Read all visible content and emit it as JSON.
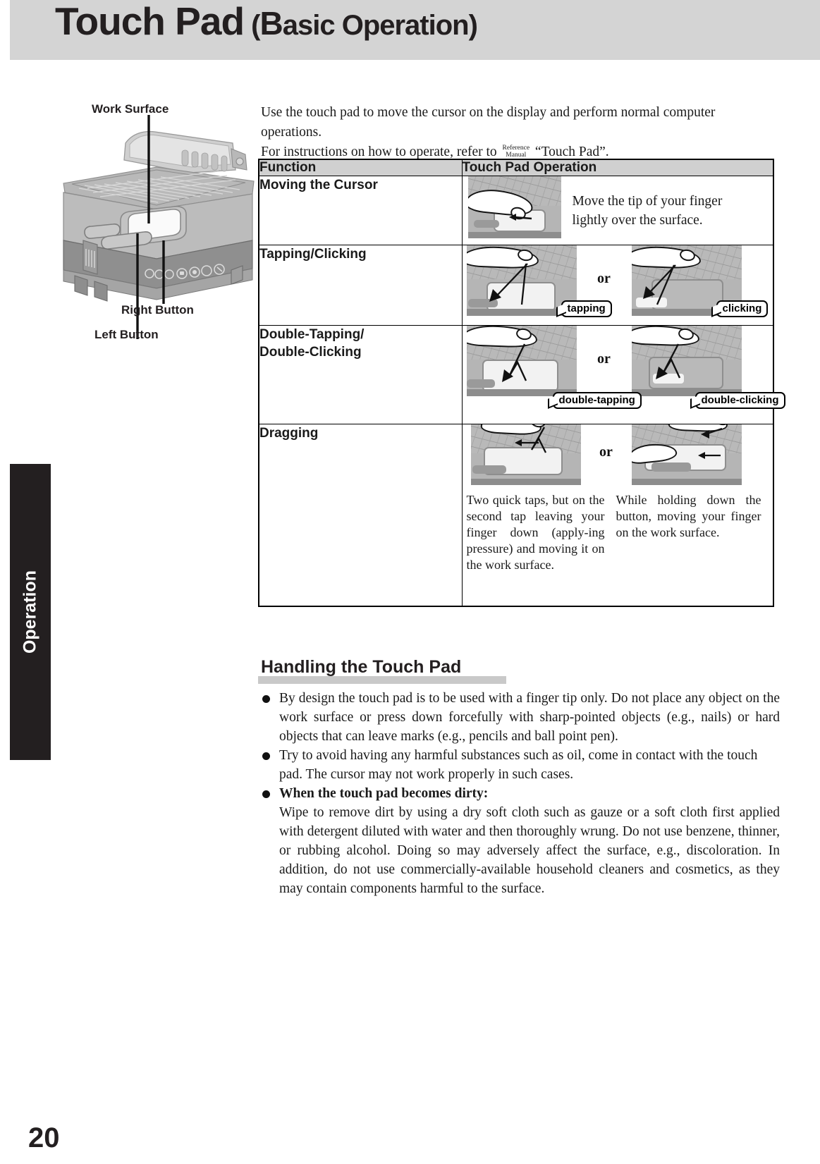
{
  "header": {
    "title_main": "Touch Pad",
    "title_paren_open": "(",
    "title_cap": "B",
    "title_rest": "asic Operation",
    "title_paren_close": ")"
  },
  "side_tab": {
    "label": "Operation"
  },
  "page": {
    "number": "20"
  },
  "illustration": {
    "labels": {
      "work_surface": "Work Surface",
      "right_button": "Right Button",
      "left_button": "Left Button"
    }
  },
  "intro": {
    "line1": "Use the touch pad to move the cursor on the display and perform normal computer operations.",
    "line2_a": "For instructions on how to operate, refer to",
    "ref_icon_line1": "Reference",
    "ref_icon_line2": "Manual",
    "line2_b": "“Touch Pad”."
  },
  "table": {
    "headers": {
      "function": "Function",
      "operation": "Touch Pad Operation"
    },
    "rows": [
      {
        "function": "Moving the Cursor",
        "description": "Move the tip of your finger lightly over the surface."
      },
      {
        "function": "Tapping/Clicking",
        "or": "or",
        "callout_left": "tapping",
        "callout_right": "clicking"
      },
      {
        "function_line1": "Double-Tapping/",
        "function_line2": "Double-Clicking",
        "or": "or",
        "callout_left": "double-tapping",
        "callout_right": "double-clicking"
      },
      {
        "function": "Dragging",
        "or": "or",
        "desc_left": "Two quick taps, but on the second tap leaving your finger down (apply-ing pressure) and moving it on the work surface.",
        "desc_right": "While holding down the button, moving your finger on the work surface."
      }
    ]
  },
  "handling": {
    "heading": "Handling the Touch Pad",
    "bullets": [
      {
        "text": "By design the touch pad is to be used with a finger tip only.  Do not place any object on the work surface or press down forcefully with sharp-pointed objects (e.g., nails) or hard objects that can leave marks (e.g., pencils and ball point pen)."
      },
      {
        "text": "Try to avoid having any harmful substances such as oil, come in contact with the touch pad. The cursor may not work properly in such cases."
      },
      {
        "bold_lead": "When the touch pad becomes dirty:",
        "text": "Wipe to remove dirt by using a dry soft cloth such as gauze or a soft cloth first applied with detergent diluted with water and then thoroughly wrung. Do not use benzene, thinner, or rubbing alcohol.  Doing so may adversely affect the surface, e.g., discoloration. In addition, do not use commercially-available household cleaners and cosmetics, as they may contain components harmful to the surface."
      }
    ]
  },
  "colors": {
    "header_band": "#d4d4d4",
    "table_header": "#d0d0d0",
    "side_tab": "#231f20",
    "heading_bar": "#c9c9c9",
    "ink": "#231f20"
  }
}
